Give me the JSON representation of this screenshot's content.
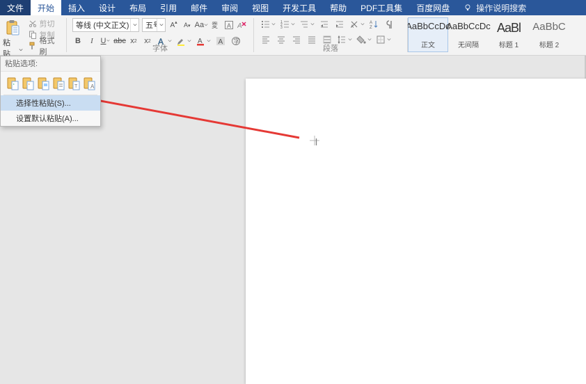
{
  "tabs": {
    "file": "文件",
    "home": "开始",
    "items": [
      "插入",
      "设计",
      "布局",
      "引用",
      "邮件",
      "审阅",
      "视图",
      "开发工具",
      "帮助",
      "PDF工具集",
      "百度网盘"
    ]
  },
  "tell_me": "操作说明搜索",
  "clipboard": {
    "paste": "粘贴",
    "cut": "剪切",
    "copy": "复制",
    "format_painter": "格式刷"
  },
  "font": {
    "name": "等线 (中文正文)",
    "size": "五号",
    "group_label": "字体"
  },
  "paragraph": {
    "group_label": "段落"
  },
  "styles": {
    "items": [
      {
        "preview": "AaBbCcDc",
        "name": "正文",
        "big": false
      },
      {
        "preview": "AaBbCcDc",
        "name": "无间隔",
        "big": false
      },
      {
        "preview": "AaBl",
        "name": "标题 1",
        "big": true
      },
      {
        "preview": "AaBbC",
        "name": "标题 2",
        "big": false
      }
    ]
  },
  "paste_dropdown": {
    "header": "粘贴选项:",
    "special": "选择性粘贴(S)...",
    "default": "设置默认粘贴(A)..."
  }
}
